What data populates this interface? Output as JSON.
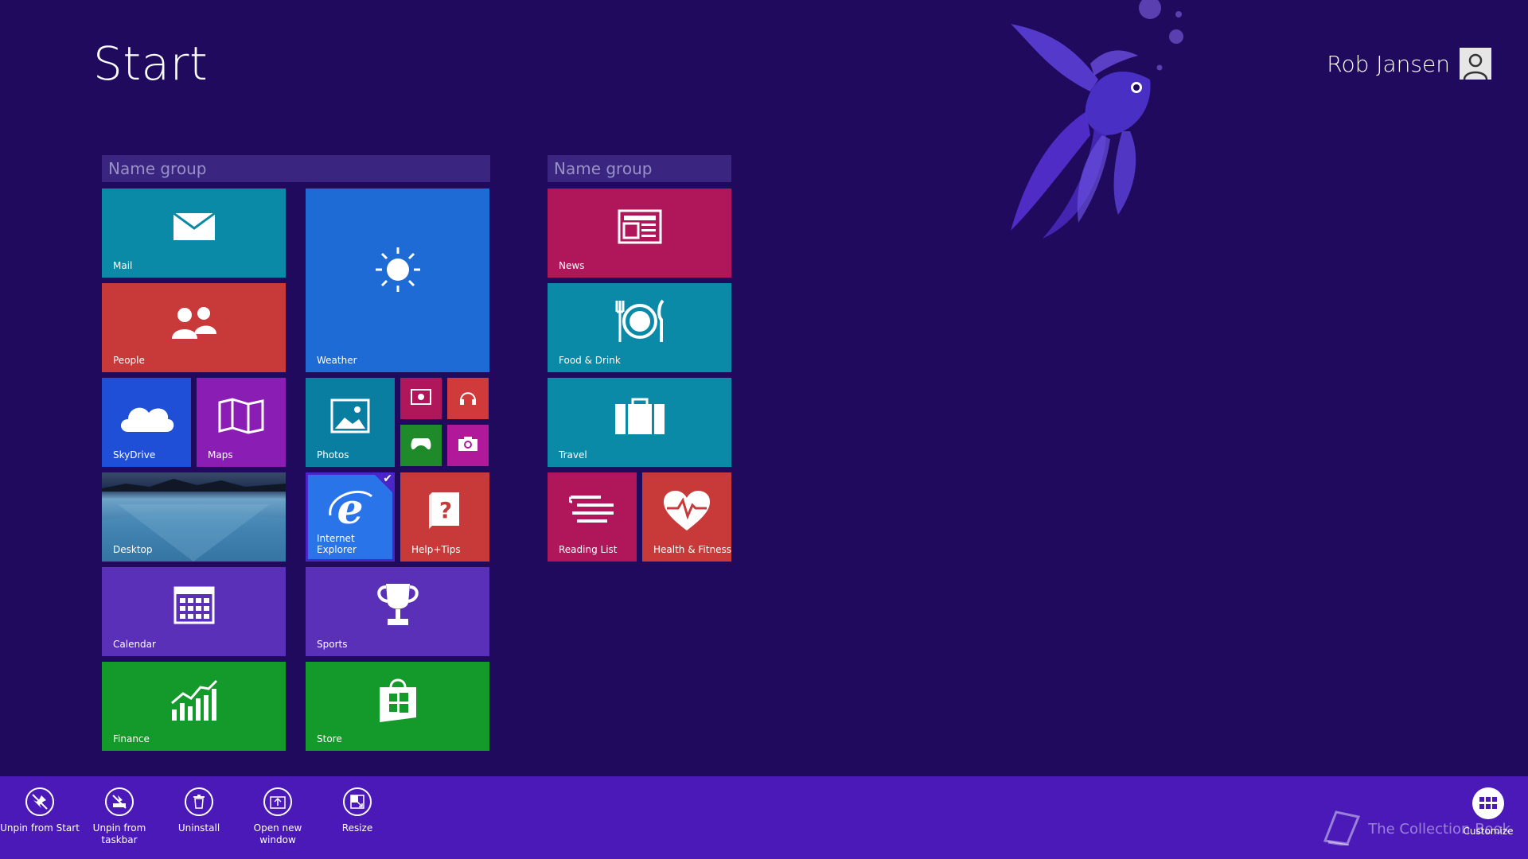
{
  "page": {
    "title": "Start",
    "user_name": "Rob Jansen"
  },
  "groups": [
    {
      "name": "Name group"
    },
    {
      "name": "Name group"
    }
  ],
  "tiles": {
    "mail": "Mail",
    "weather": "Weather",
    "people": "People",
    "skydrive": "SkyDrive",
    "maps": "Maps",
    "photos": "Photos",
    "desktop": "Desktop",
    "internet_explorer": "Internet Explorer",
    "help_tips": "Help+Tips",
    "calendar": "Calendar",
    "sports": "Sports",
    "finance": "Finance",
    "store": "Store",
    "news": "News",
    "food_drink": "Food & Drink",
    "travel": "Travel",
    "reading_list": "Reading List",
    "health_fitness": "Health & Fitness"
  },
  "app_bar": {
    "unpin_start": "Unpin from Start",
    "unpin_taskbar": [
      "Unpin from",
      "taskbar"
    ],
    "uninstall": "Uninstall",
    "open_new_window": [
      "Open new",
      "window"
    ],
    "resize": "Resize",
    "customize": "Customize"
  },
  "watermark": "The Collection Book",
  "colors": {
    "background": "#1f0a5e",
    "app_bar": "#4a19b8",
    "selection": "#4a26c8"
  }
}
